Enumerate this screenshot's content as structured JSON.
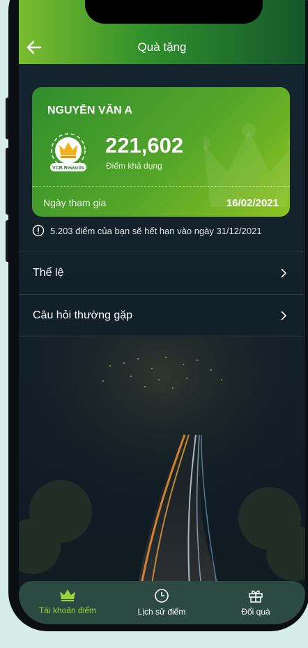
{
  "header": {
    "title": "Quà tặng"
  },
  "card": {
    "name": "NGUYỄN VĂN A",
    "badge_text": "VCB Rewards",
    "points": "221,602",
    "points_label": "Điểm khả dụng",
    "join_label": "Ngày tham gia",
    "join_date": "16/02/2021"
  },
  "notice": {
    "text": "5.203 điểm của bạn sẽ hết hạn vào ngày 31/12/2021"
  },
  "menu": {
    "items": [
      {
        "label": "Thể lệ"
      },
      {
        "label": "Câu hỏi thường gặp"
      }
    ]
  },
  "tabs": {
    "items": [
      {
        "label": "Tài khoản điểm"
      },
      {
        "label": "Lịch sử điểm"
      },
      {
        "label": "Đổi quà"
      }
    ]
  },
  "colors": {
    "accent": "#8cc63f",
    "active_tab": "#9bd33c",
    "tabbar": "#2c4a42"
  }
}
